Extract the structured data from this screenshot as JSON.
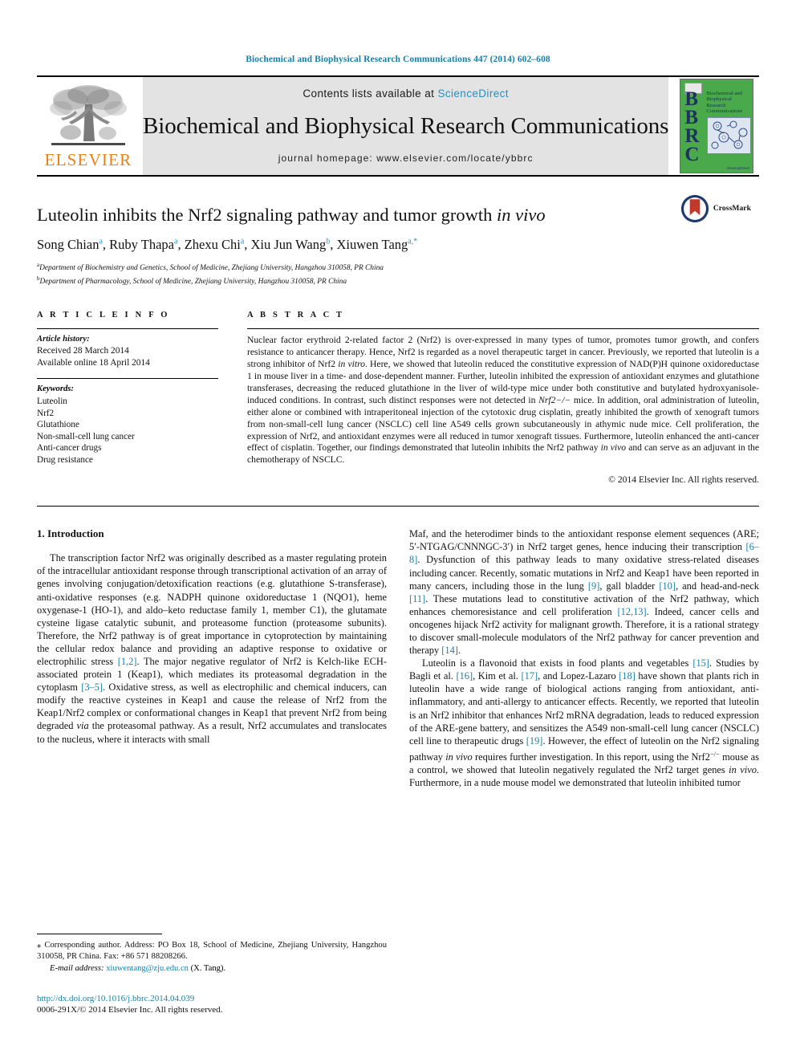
{
  "running_head": "Biochemical and Biophysical Research Communications 447 (2014) 602–608",
  "masthead": {
    "publisher": "ELSEVIER",
    "contents_prefix": "Contents lists available at ",
    "sciencedirect": "ScienceDirect",
    "journal_title": "Biochemical and Biophysical Research Communications",
    "homepage": "journal homepage: www.elsevier.com/locate/ybbrc",
    "cover": {
      "letters": "BBRC",
      "headline": "Biochemical and Biophysical Research Communications",
      "footer": "ScienceDirect"
    }
  },
  "article": {
    "title_main": "Luteolin inhibits the Nrf2 signaling pathway and tumor growth ",
    "title_italic": "in vivo",
    "crossmark_label": "CrossMark",
    "authors": [
      {
        "name": "Song Chian",
        "sup": "a"
      },
      {
        "name": "Ruby Thapa",
        "sup": "a"
      },
      {
        "name": "Zhexu Chi",
        "sup": "a"
      },
      {
        "name": "Xiu Jun Wang",
        "sup": "b"
      },
      {
        "name": "Xiuwen Tang",
        "sup": "a,*"
      }
    ],
    "affiliations": [
      {
        "mark": "a",
        "text": "Department of Biochemistry and Genetics, School of Medicine, Zhejiang University, Hangzhou 310058, PR China"
      },
      {
        "mark": "b",
        "text": "Department of Pharmacology, School of Medicine, Zhejiang University, Hangzhou 310058, PR China"
      }
    ]
  },
  "info": {
    "heading": "A R T I C L E    I N F O",
    "history_label": "Article history:",
    "history": [
      "Received 28 March 2014",
      "Available online 18 April 2014"
    ],
    "keywords_label": "Keywords:",
    "keywords": [
      "Luteolin",
      "Nrf2",
      "Glutathione",
      "Non-small-cell lung cancer",
      "Anti-cancer drugs",
      "Drug resistance"
    ]
  },
  "abstract": {
    "heading": "A B S T R A C T",
    "text_1": "Nuclear factor erythroid 2-related factor 2 (Nrf2) is over-expressed in many types of tumor, promotes tumor growth, and confers resistance to anticancer therapy. Hence, Nrf2 is regarded as a novel therapeutic target in cancer. Previously, we reported that luteolin is a strong inhibitor of Nrf2 ",
    "italic_1": "in vitro",
    "text_2": ". Here, we showed that luteolin reduced the constitutive expression of NAD(P)H quinone oxidoreductase 1 in mouse liver in a time- and dose-dependent manner. Further, luteolin inhibited the expression of antioxidant enzymes and glutathione transferases, decreasing the reduced glutathione in the liver of wild-type mice under both constitutive and butylated hydroxyanisole-induced conditions. In contrast, such distinct responses were not detected in ",
    "italic_2": "Nrf2−/−",
    "text_3": " mice. In addition, oral administration of luteolin, either alone or combined with intraperitoneal injection of the cytotoxic drug cisplatin, greatly inhibited the growth of xenograft tumors from non-small-cell lung cancer (NSCLC) cell line A549 cells grown subcutaneously in athymic nude mice. Cell proliferation, the expression of Nrf2, and antioxidant enzymes were all reduced in tumor xenograft tissues. Furthermore, luteolin enhanced the anti-cancer effect of cisplatin. Together, our findings demonstrated that luteolin inhibits the Nrf2 pathway ",
    "italic_3": "in vivo",
    "text_4": " and can serve as an adjuvant in the chemotherapy of NSCLC.",
    "copyright": "© 2014 Elsevier Inc. All rights reserved."
  },
  "body": {
    "section_heading": "1. Introduction",
    "left_para_1_a": "The transcription factor Nrf2 was originally described as a master regulating protein of the intracellular antioxidant response through transcriptional activation of an array of genes involving conjugation/detoxification reactions (e.g. glutathione S-transferase), anti-oxidative responses (e.g. NADPH quinone oxidoreductase 1 (NQO1), heme oxygenase-1 (HO-1), and aldo–keto reductase family 1, member C1), the glutamate cysteine ligase catalytic subunit, and proteasome function (proteasome subunits). Therefore, the Nrf2 pathway is of great importance in cytoprotection by maintaining the cellular redox balance and providing an adaptive response to oxidative or electrophilic stress ",
    "left_ref_1": "[1,2]",
    "left_para_1_b": ". The major negative regulator of Nrf2 is Kelch-like ECH-associated protein 1 (Keap1), which mediates its proteasomal degradation in the cytoplasm ",
    "left_ref_2": "[3–5]",
    "left_para_1_c": ". Oxidative stress, as well as electrophilic and chemical inducers, can modify the reactive cysteines in Keap1 and cause the release of Nrf2 from the Keap1/Nrf2 complex or conformational changes in Keap1 that prevent Nrf2 from being degraded ",
    "left_italic_1": "via",
    "left_para_1_d": " the proteasomal pathway. As a result, Nrf2 accumulates and translocates to the nucleus, where it interacts with small",
    "right_para_1_a": "Maf, and the heterodimer binds to the antioxidant response element sequences (ARE; 5′-NTGAG/CNNNGC-3′) in Nrf2 target genes, hence inducing their transcription ",
    "right_ref_1": "[6–8]",
    "right_para_1_b": ". Dysfunction of this pathway leads to many oxidative stress-related diseases including cancer. Recently, somatic mutations in Nrf2 and Keap1 have been reported in many cancers, including those in the lung ",
    "right_ref_2": "[9]",
    "right_para_1_c": ", gall bladder ",
    "right_ref_3": "[10]",
    "right_para_1_d": ", and head-and-neck ",
    "right_ref_4": "[11]",
    "right_para_1_e": ". These mutations lead to constitutive activation of the Nrf2 pathway, which enhances chemoresistance and cell proliferation ",
    "right_ref_5": "[12,13]",
    "right_para_1_f": ". Indeed, cancer cells and oncogenes hijack Nrf2 activity for malignant growth. Therefore, it is a rational strategy to discover small-molecule modulators of the Nrf2 pathway for cancer prevention and therapy ",
    "right_ref_6": "[14]",
    "right_para_1_g": ".",
    "right_para_2_a": "Luteolin is a flavonoid that exists in food plants and vegetables ",
    "right_ref_7": "[15]",
    "right_para_2_b": ". Studies by Bagli et al. ",
    "right_ref_8": "[16]",
    "right_para_2_c": ", Kim et al. ",
    "right_ref_9": "[17]",
    "right_para_2_d": ", and Lopez-Lazaro ",
    "right_ref_10": "[18]",
    "right_para_2_e": " have shown that plants rich in luteolin have a wide range of biological actions ranging from antioxidant, anti-inflammatory, and anti-allergy to anticancer effects. Recently, we reported that luteolin is an Nrf2 inhibitor that enhances Nrf2 mRNA degradation, leads to reduced expression of the ARE-gene battery, and sensitizes the A549 non-small-cell lung cancer (NSCLC) cell line to therapeutic drugs ",
    "right_ref_11": "[19]",
    "right_para_2_f": ". However, the effect of luteolin on the Nrf2 signaling pathway ",
    "right_italic_1": "in vivo",
    "right_para_2_g": " requires further investigation. In this report, using the Nrf2",
    "right_sup_1": "−/−",
    "right_para_2_h": " mouse as a control, we showed that luteolin negatively regulated the Nrf2 target genes ",
    "right_italic_2": "in vivo",
    "right_para_2_i": ". Furthermore, in a nude mouse model we demonstrated that luteolin inhibited tumor"
  },
  "footnote": {
    "corresponding": "⁎ Corresponding author. Address: PO Box 18, School of Medicine, Zhejiang University, Hangzhou 310058, PR China. Fax: +86 571 88208266.",
    "email_label": "E-mail address:",
    "email": "xiuwentang@zju.edu.cn",
    "email_suffix": "(X. Tang).",
    "doi": "http://dx.doi.org/10.1016/j.bbrc.2014.04.039",
    "issn": "0006-291X/© 2014 Elsevier Inc. All rights reserved."
  },
  "colors": {
    "link": "#1a7fa8",
    "sciencedirect": "#2a8fbd",
    "elsevier_orange": "#f07f13",
    "cover_green": "#4aa94a",
    "cover_blue": "#20305f"
  }
}
